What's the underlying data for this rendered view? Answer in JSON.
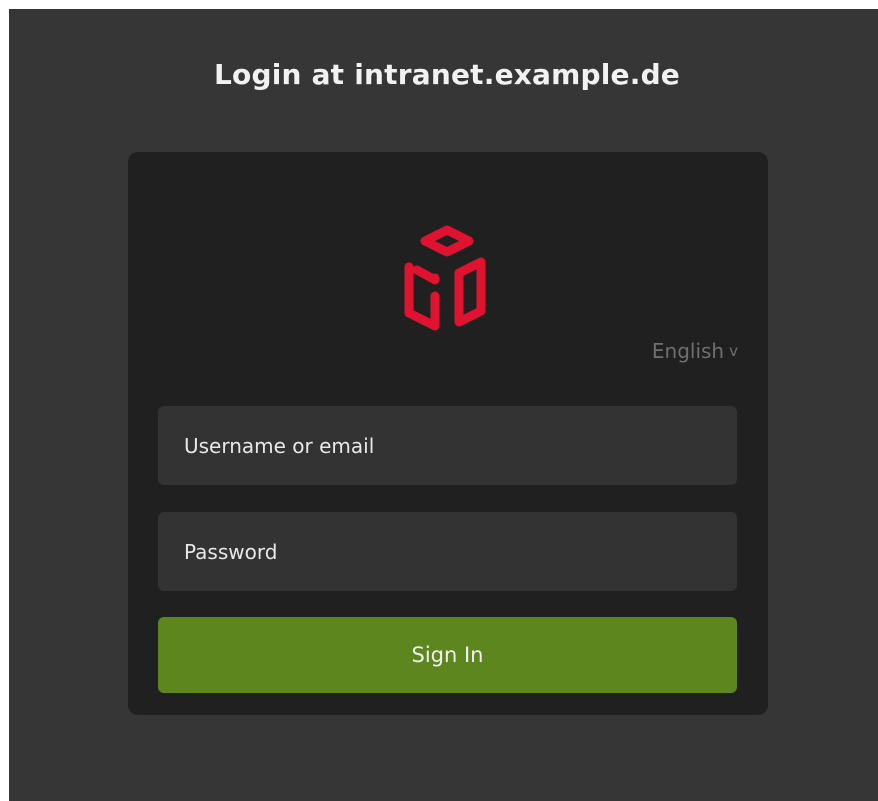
{
  "page": {
    "title": "Login at intranet.example.de"
  },
  "logo": {
    "icon": "red-cube-logo-icon",
    "color": "#e0122f"
  },
  "language": {
    "selected": "English",
    "chevron": "v"
  },
  "form": {
    "username_placeholder": "Username or email",
    "password_placeholder": "Password",
    "submit_label": "Sign In"
  },
  "colors": {
    "background": "#363636",
    "card": "#202020",
    "input": "#333333",
    "button": "#5e861f",
    "accent": "#e0122f"
  }
}
